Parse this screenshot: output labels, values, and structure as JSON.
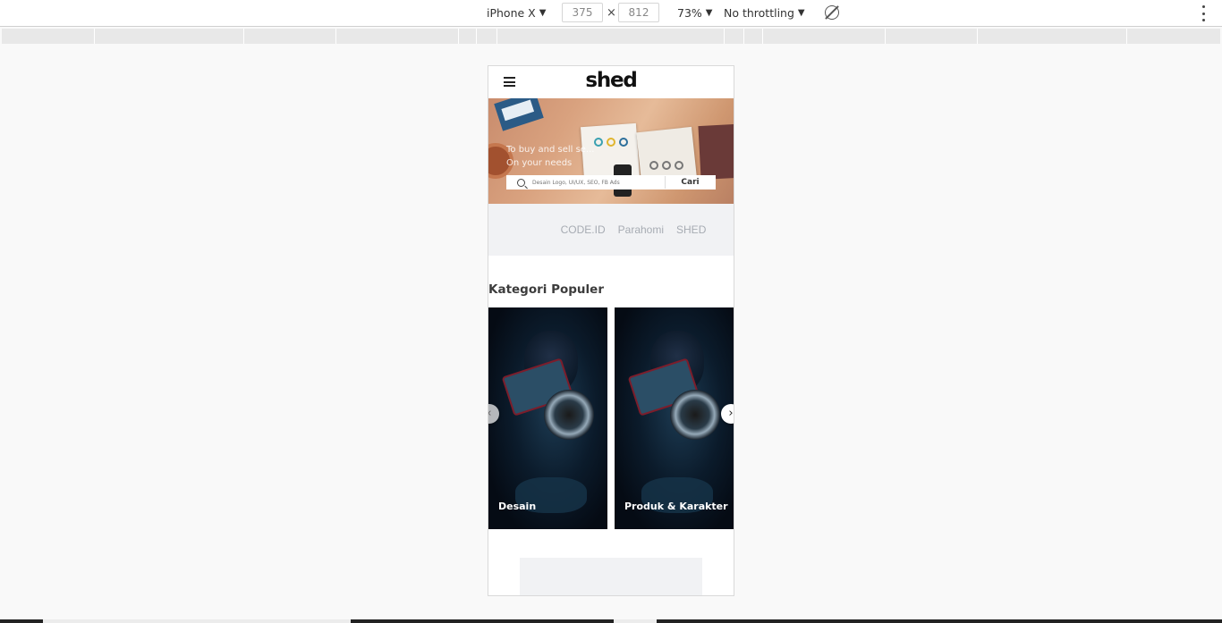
{
  "devtools": {
    "device": "iPhone X",
    "width": "375",
    "height": "812",
    "times": "×",
    "zoom": "73%",
    "throttling": "No throttling",
    "dropdown_glyph": "▼"
  },
  "app": {
    "logo": "shed",
    "hero": {
      "tagline_line1": "To buy and sell se...",
      "tagline_line2": "On your needs",
      "search_placeholder": "Desain Logo, UI/UX, SEO, FB Ads",
      "search_button": "Cari"
    },
    "partners": [
      "CODE.ID",
      "Parahomi",
      "SHED"
    ],
    "section_title": "Kategori Populer",
    "categories": [
      "Desain",
      "Produk & Karakter"
    ],
    "arrows": {
      "prev": "‹",
      "next": "›"
    }
  }
}
